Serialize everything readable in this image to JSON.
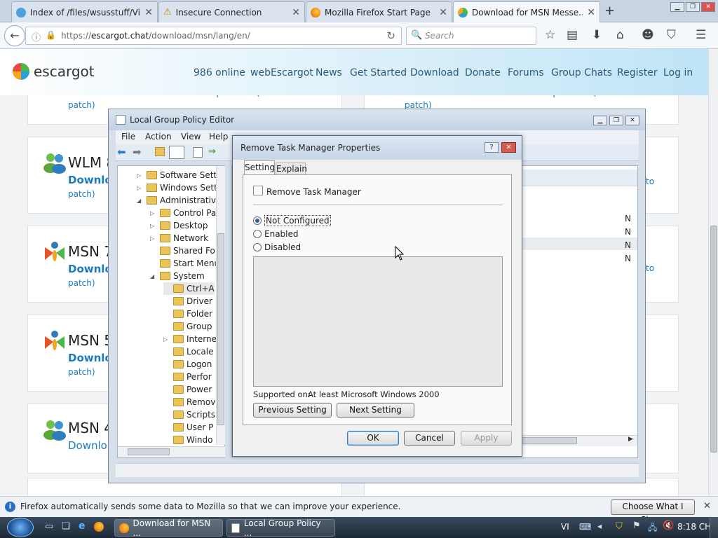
{
  "tabs": [
    {
      "title": "Index of /files/wsusstuff/Vi...",
      "active": false
    },
    {
      "title": "Insecure Connection",
      "active": false
    },
    {
      "title": "Mozilla Firefox Start Page",
      "active": false
    },
    {
      "title": "Download for MSN Messe...",
      "active": true
    }
  ],
  "url": {
    "scheme": "https://",
    "host": "escargot.chat",
    "path": "/download/msn/lang/en/"
  },
  "search": {
    "placeholder": "Search"
  },
  "site": {
    "logo": "escargot",
    "nav": [
      "986 online",
      "webEscargot",
      "News",
      "Get Started",
      "Download",
      "Donate",
      "Forums",
      "Group Chats",
      "Register",
      "Log in"
    ],
    "cards": [
      {
        "title": "WLM 8",
        "link": "Downlo"
      },
      {
        "title": "MSN 7",
        "link": "Downlo"
      },
      {
        "title": "MSN 5",
        "link": "Downlo"
      },
      {
        "title": "MSN 4",
        "link": "Downloa"
      }
    ],
    "patch": "patch)",
    "overflow_top": "Download Patched  Download Unpatched (How to",
    "right_links": [
      "to",
      "to"
    ]
  },
  "gpe": {
    "title": "Local Group Policy Editor",
    "menu": [
      "File",
      "Action",
      "View",
      "Help"
    ],
    "tree": [
      {
        "label": "Software Setti",
        "indent": 1,
        "arrow": "▷"
      },
      {
        "label": "Windows Sett",
        "indent": 1,
        "arrow": "▷"
      },
      {
        "label": "Administrativ",
        "indent": 1,
        "arrow": "◢"
      },
      {
        "label": "Control Pa",
        "indent": 2,
        "arrow": "▷"
      },
      {
        "label": "Desktop",
        "indent": 2,
        "arrow": "▷"
      },
      {
        "label": "Network",
        "indent": 2,
        "arrow": "▷"
      },
      {
        "label": "Shared Fol",
        "indent": 2,
        "arrow": ""
      },
      {
        "label": "Start Menu",
        "indent": 2,
        "arrow": ""
      },
      {
        "label": "System",
        "indent": 2,
        "arrow": "◢"
      },
      {
        "label": "Ctrl+A",
        "indent": 3,
        "arrow": ""
      },
      {
        "label": "Driver",
        "indent": 3,
        "arrow": ""
      },
      {
        "label": "Folder",
        "indent": 3,
        "arrow": ""
      },
      {
        "label": "Group",
        "indent": 3,
        "arrow": ""
      },
      {
        "label": "Interne",
        "indent": 3,
        "arrow": "▷"
      },
      {
        "label": "Locale",
        "indent": 3,
        "arrow": ""
      },
      {
        "label": "Logon",
        "indent": 3,
        "arrow": ""
      },
      {
        "label": "Perfor",
        "indent": 3,
        "arrow": ""
      },
      {
        "label": "Power",
        "indent": 3,
        "arrow": ""
      },
      {
        "label": "Remov",
        "indent": 3,
        "arrow": ""
      },
      {
        "label": "Scripts",
        "indent": 3,
        "arrow": ""
      },
      {
        "label": "User P",
        "indent": 3,
        "arrow": ""
      },
      {
        "label": "Windo",
        "indent": 3,
        "arrow": ""
      }
    ],
    "right_col": [
      "N",
      "N",
      "N",
      "N"
    ]
  },
  "dialog": {
    "title": "Remove Task Manager Properties",
    "tabs": [
      "Setting",
      "Explain"
    ],
    "policy": "Remove Task Manager",
    "options": [
      "Not Configured",
      "Enabled",
      "Disabled"
    ],
    "selected": 0,
    "supported_label": "Supported on:",
    "supported_value": "At least Microsoft Windows 2000",
    "prev": "Previous Setting",
    "next": "Next Setting",
    "ok": "OK",
    "cancel": "Cancel",
    "apply": "Apply"
  },
  "notification": {
    "text": "Firefox automatically sends some data to Mozilla so that we can improve your experience.",
    "button": "Choose What I Share"
  },
  "taskbar": {
    "tasks": [
      "Download for MSN ...",
      "Local Group Policy ..."
    ],
    "lang": "VI",
    "time": "8:18 CH"
  }
}
